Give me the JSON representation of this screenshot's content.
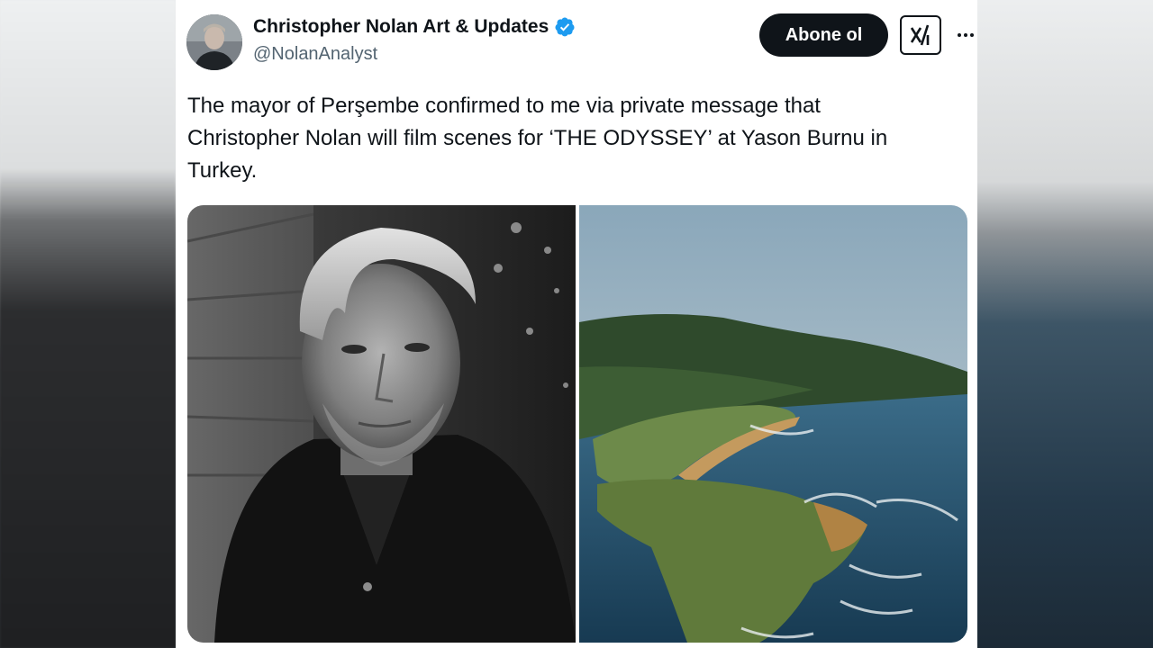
{
  "tweet": {
    "author": {
      "display_name": "Christopher Nolan Art & Updates",
      "handle": "@NolanAnalyst",
      "verified_icon": "verified-badge-icon"
    },
    "follow_label": "Abone ol",
    "text_lines": [
      "The mayor of Perşembe confirmed to me via private message that",
      "Christopher Nolan will film scenes for ‘THE ODYSSEY’ at Yason Burnu in",
      "Turkey."
    ],
    "media": [
      "portrait-photo",
      "coastline-photo"
    ]
  },
  "colors": {
    "text": "#0f1419",
    "secondary": "#536471",
    "verified": "#1d9bf0",
    "follow_bg": "#0f1419"
  }
}
